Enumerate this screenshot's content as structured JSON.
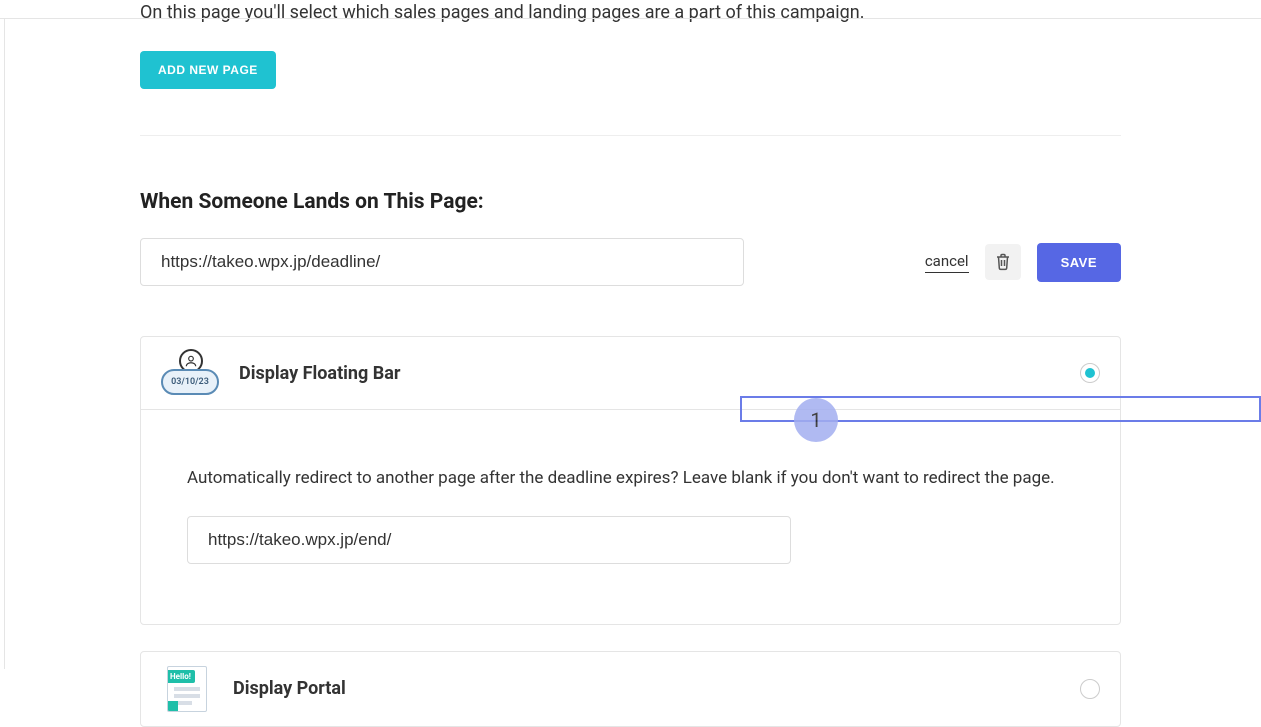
{
  "intro": "On this page you'll select which sales pages and landing pages are a part of this campaign.",
  "add_button": "ADD NEW PAGE",
  "section_heading": "When Someone Lands on This Page:",
  "page_url": "https://takeo.wpx.jp/deadline/",
  "actions": {
    "cancel": "cancel",
    "save": "SAVE"
  },
  "floating_bar": {
    "title": "Display Floating Bar",
    "icon_date": "03/10/23",
    "body_text": "Automatically redirect to another page after the deadline expires? Leave blank if you don't want to redirect the page.",
    "redirect_url": "https://takeo.wpx.jp/end/"
  },
  "portal": {
    "title": "Display Portal",
    "bubble": "Hello!"
  },
  "annotation": {
    "number": "1"
  }
}
